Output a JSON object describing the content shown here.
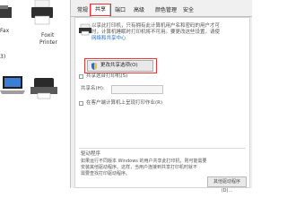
{
  "devices": [
    {
      "label": "Fax"
    },
    {
      "label": "Foxit"
    },
    {
      "label": "Printer"
    }
  ],
  "section_count": "3)",
  "tabs": [
    {
      "label": "常规"
    },
    {
      "label": "共享"
    },
    {
      "label": "端口"
    },
    {
      "label": "高级"
    },
    {
      "label": "颜色管理"
    },
    {
      "label": "安全"
    }
  ],
  "share": {
    "intro_line1": "以享此打印机，只有拥有此计算机用户名和密码的用户才可",
    "intro_line2": "时，计算机睡眠时打印机将不可用。要更改这些设置，请使",
    "intro_link": "网络和共享中心",
    "options_button": "更改共享选项(O)",
    "share_checkbox": "共享这台打印机(S)",
    "share_name_label": "共享名(H):",
    "render_checkbox": "在客户端计算机上呈现打印作业(R)",
    "drivers_title": "驱动程序",
    "drivers_line1": "如果运行不同版本 Windows 的用户共享此打印机，则可能需要",
    "drivers_line2": "安装其他驱动程序。这样，当用户连接到共享打印机时就不",
    "drivers_line3": "需要查找打印驱动程序。",
    "extra_drivers_button": "其他驱动程序(D)..."
  }
}
